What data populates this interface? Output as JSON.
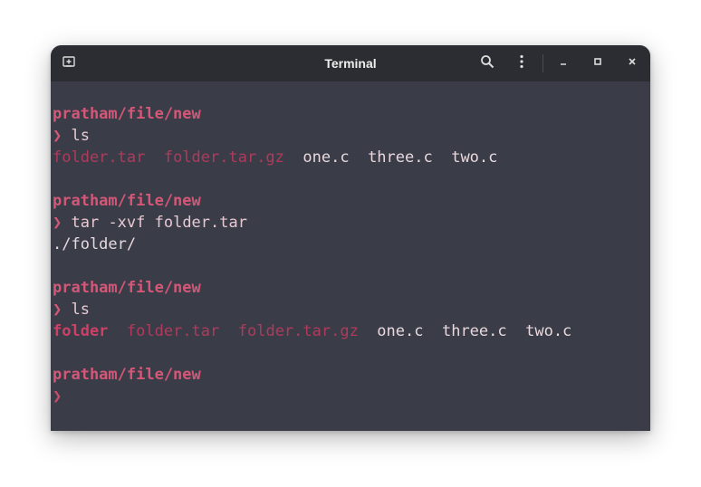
{
  "window": {
    "title": "Terminal"
  },
  "icons": {
    "new_tab": "new-tab-icon",
    "search": "search-icon",
    "menu": "kebab-menu-icon",
    "minimize": "minimize-icon",
    "maximize": "maximize-icon",
    "close": "close-icon"
  },
  "colors": {
    "terminal_bg": "#3a3d48",
    "titlebar_bg": "#2b2d33",
    "prompt": "#d45777",
    "archive": "#b03a5c",
    "directory": "#cf3f66",
    "text": "#e8c9d2"
  },
  "terminal": {
    "prompt_symbol": "❯",
    "blocks": [
      {
        "path": "pratham/file/new",
        "command": "ls",
        "output": {
          "ls_items": [
            {
              "name": "folder.tar",
              "type": "archive"
            },
            {
              "name": "folder.tar.gz",
              "type": "archive"
            },
            {
              "name": "one.c",
              "type": "file"
            },
            {
              "name": "three.c",
              "type": "file"
            },
            {
              "name": "two.c",
              "type": "file"
            }
          ]
        }
      },
      {
        "path": "pratham/file/new",
        "command": "tar -xvf folder.tar",
        "output": {
          "text": "./folder/"
        }
      },
      {
        "path": "pratham/file/new",
        "command": "ls",
        "output": {
          "ls_items": [
            {
              "name": "folder",
              "type": "directory"
            },
            {
              "name": "folder.tar",
              "type": "archive"
            },
            {
              "name": "folder.tar.gz",
              "type": "archive"
            },
            {
              "name": "one.c",
              "type": "file"
            },
            {
              "name": "three.c",
              "type": "file"
            },
            {
              "name": "two.c",
              "type": "file"
            }
          ]
        }
      },
      {
        "path": "pratham/file/new",
        "command": ""
      }
    ]
  }
}
